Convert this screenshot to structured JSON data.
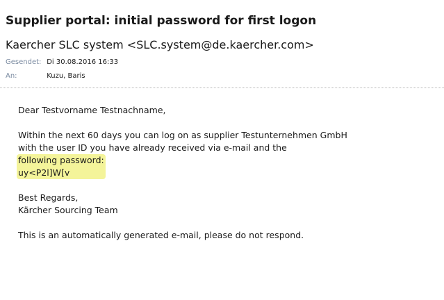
{
  "email": {
    "subject": "Supplier portal: initial password for first logon",
    "sender": "Kaercher SLC system <SLC.system@de.kaercher.com>",
    "sent_label": "Gesendet:",
    "sent_value": "Di 30.08.2016 16:33",
    "to_label": "An:",
    "to_value": "Kuzu, Baris"
  },
  "body": {
    "greeting": "Dear  Testvorname Testnachname,",
    "paragraph_line1": "Within the next 60  days you can log on as supplier Testunternehmen GmbH",
    "paragraph_line2": "with the user ID you have already received via e-mail and the",
    "highlight_line1": "following password:",
    "highlight_line2": "uy<P2l]W[v",
    "closing": "Best Regards,",
    "signature": "Kärcher Sourcing Team",
    "footer": "This is an automatically generated e-mail, please do not respond."
  },
  "colors": {
    "highlight": "#f4f49a",
    "meta_label": "#7a8aa0",
    "text": "#1a1a1a"
  }
}
